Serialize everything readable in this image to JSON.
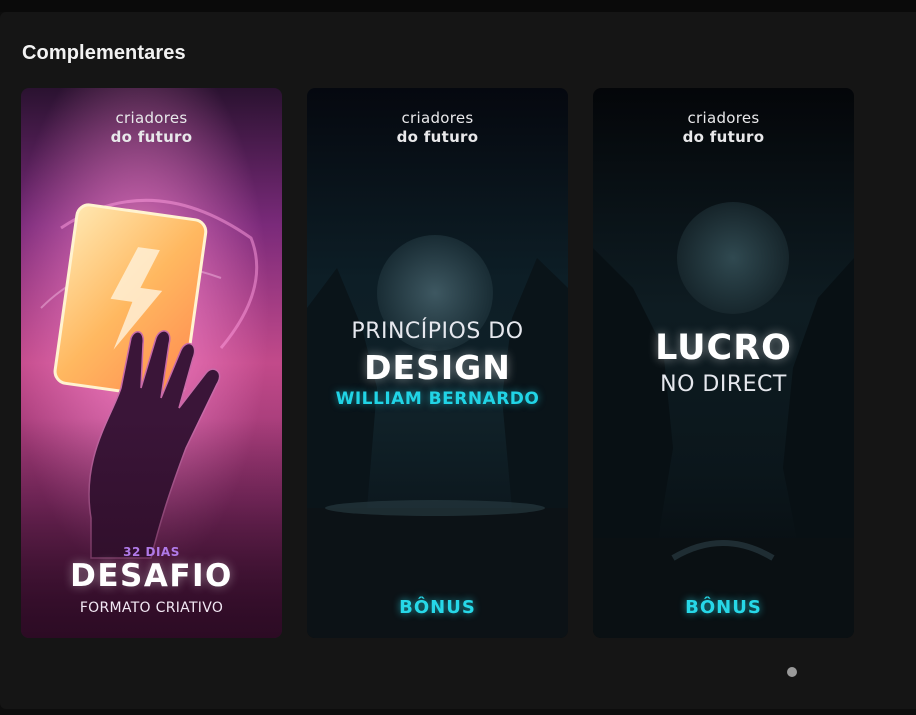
{
  "section": {
    "title": "Complementares"
  },
  "cards": [
    {
      "brand_line1": "criadores",
      "brand_line2": "do futuro",
      "tag": "32 DIAS",
      "title": "DESAFIO",
      "subtitle": "FORMATO CRIATIVO"
    },
    {
      "brand_line1": "criadores",
      "brand_line2": "do futuro",
      "line1": "PRINCÍPIOS DO",
      "line2": "DESIGN",
      "line3": "WILLIAM BERNARDO",
      "badge": "BÔNUS"
    },
    {
      "brand_line1": "criadores",
      "brand_line2": "do futuro",
      "line1": "LUCRO",
      "line2": "NO DIRECT",
      "badge": "BÔNUS"
    }
  ],
  "pagination": {
    "active_page": 1
  },
  "colors": {
    "background": "#151515",
    "accent_cyan": "#21d4e6",
    "desafio_purple": "#b07ae8"
  }
}
